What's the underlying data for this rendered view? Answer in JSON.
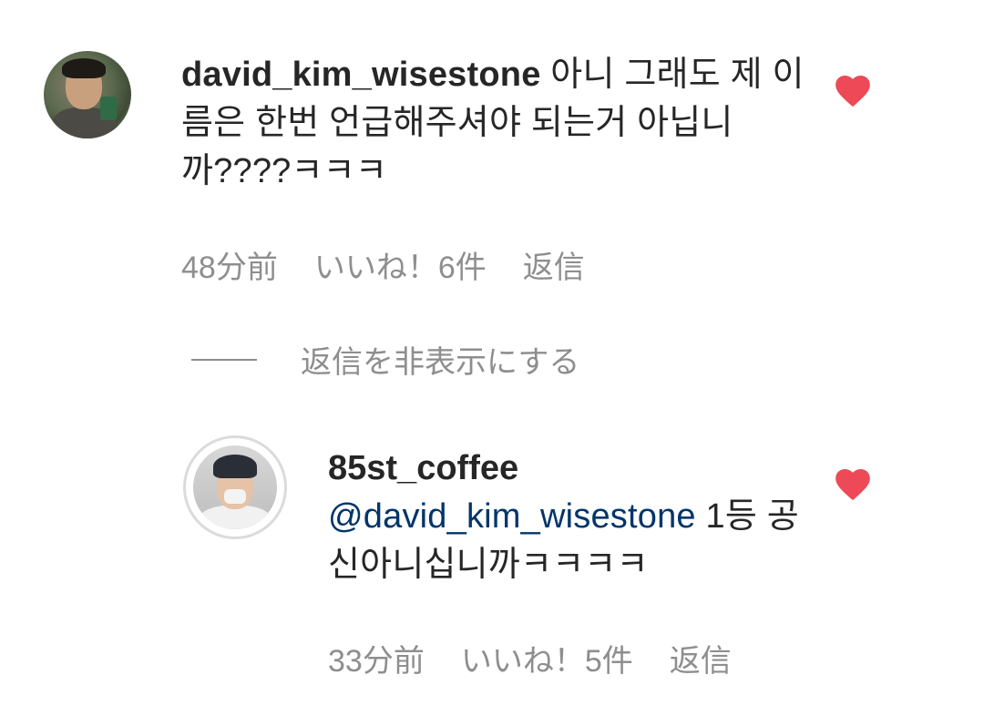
{
  "comment": {
    "username": "david_kim_wisestone",
    "text": "아니 그래도 제 이름은 한번 언급해주셔야 되는거 아닙니까????ㅋㅋㅋ",
    "time": "48分前",
    "likes": "いいね！6件",
    "reply_label": "返信",
    "liked": true
  },
  "hide_replies_label": "返信を非表示にする",
  "reply": {
    "username": "85st_coffee",
    "mention": "@david_kim_wisestone",
    "text": " 1등 공신아니십니까ㅋㅋㅋㅋ",
    "time": "33分前",
    "likes": "いいね！5件",
    "reply_label": "返信",
    "liked": true
  },
  "colors": {
    "heart": "#ed4956",
    "meta": "#8e8e8e",
    "mention": "#003569",
    "text": "#262626"
  }
}
